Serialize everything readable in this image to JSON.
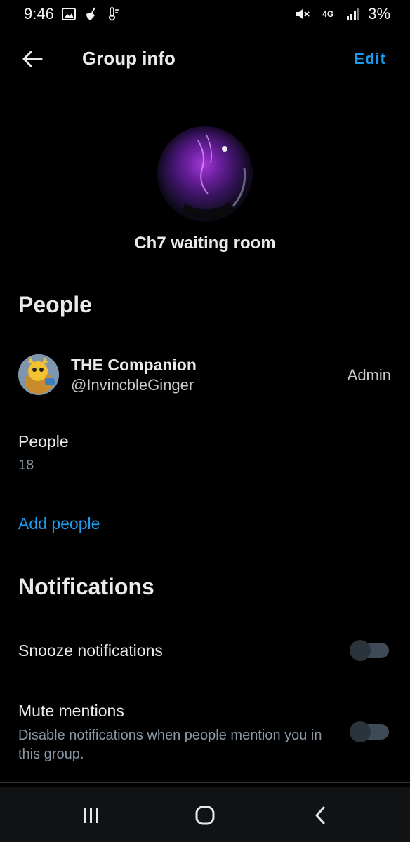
{
  "status_bar": {
    "time": "9:46",
    "battery": "3%",
    "network": "4G"
  },
  "header": {
    "title": "Group info",
    "edit_label": "Edit"
  },
  "group": {
    "name": "Ch7 waiting room"
  },
  "people": {
    "heading": "People",
    "members": [
      {
        "name": "THE Companion",
        "handle": "@InvincbleGinger",
        "role": "Admin"
      }
    ],
    "count_label": "People",
    "count_value": "18",
    "add_label": "Add people"
  },
  "notifications": {
    "heading": "Notifications",
    "settings": [
      {
        "label": "Snooze notifications",
        "enabled": false
      },
      {
        "label": "Mute mentions",
        "description": "Disable notifications when people mention you in this group.",
        "enabled": false
      }
    ]
  },
  "colors": {
    "background": "#000000",
    "accent": "#1d9bf0",
    "text_primary": "#e7e9ea",
    "text_secondary": "#8b98a5",
    "divider": "#2f3336"
  },
  "icons": {
    "status_left": [
      "gallery-icon",
      "cleaner-icon",
      "thermometer-icon"
    ],
    "status_right": [
      "mute-icon",
      "network-4g-icon",
      "signal-icon"
    ],
    "nav": [
      "recents-icon",
      "home-icon",
      "back-icon"
    ]
  }
}
